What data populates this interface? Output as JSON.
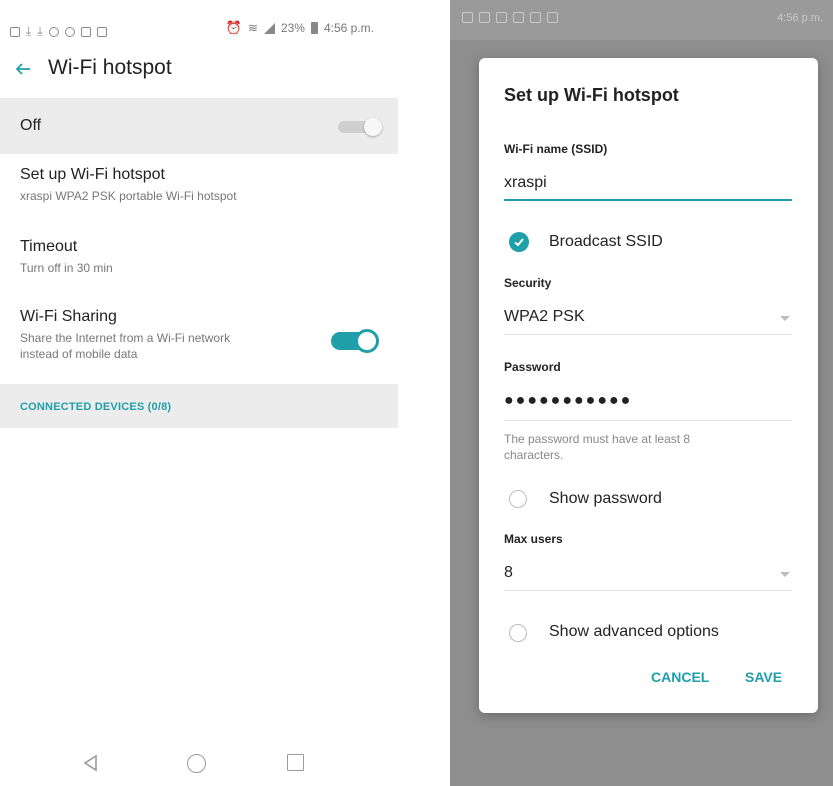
{
  "status_bar": {
    "battery": "23%",
    "time": "4:56 p.m."
  },
  "left": {
    "app_title": "Wi-Fi hotspot",
    "off_label": "Off",
    "items": [
      {
        "title": "Set up Wi-Fi hotspot",
        "subtitle": "xraspi WPA2 PSK portable Wi-Fi hotspot"
      },
      {
        "title": "Timeout",
        "subtitle": "Turn off in 30 min"
      },
      {
        "title": "Wi-Fi Sharing",
        "subtitle_line1": "Share the Internet from a Wi-Fi network",
        "subtitle_line2": "instead of mobile data"
      }
    ],
    "hotspot_enabled": false,
    "wifi_sharing_enabled": true,
    "section_header": "CONNECTED DEVICES (0/8)"
  },
  "dialog": {
    "title": "Set up Wi-Fi hotspot",
    "ssid_label": "Wi-Fi name (SSID)",
    "ssid_value": "xraspi",
    "broadcast_label": "Broadcast SSID",
    "broadcast_checked": true,
    "security_label": "Security",
    "security_value": "WPA2 PSK",
    "password_label": "Password",
    "password_mask": "●●●●●●●●●●●",
    "password_hint_line1": "The password must have at least 8",
    "password_hint_line2": "characters.",
    "show_password_label": "Show password",
    "show_password_checked": false,
    "max_users_label": "Max users",
    "max_users_value": "8",
    "advanced_label": "Show advanced options",
    "advanced_checked": false,
    "cancel_label": "CANCEL",
    "save_label": "SAVE"
  },
  "colors": {
    "accent": "#1f9fa8",
    "section_bg": "#ececec",
    "scrim": "#8e8e8e"
  }
}
